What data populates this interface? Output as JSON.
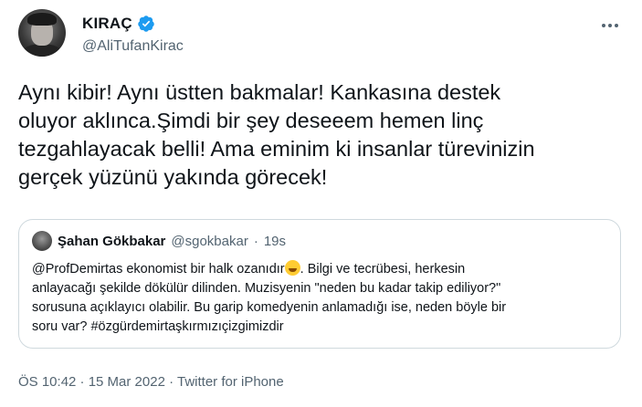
{
  "author": {
    "name": "KIRAÇ",
    "handle": "@AliTufanKirac"
  },
  "tweet": {
    "lines": [
      "Aynı kibir! Aynı üstten bakmalar! Kankasına destek",
      "oluyor aklınca.Şimdi bir şey deseeem hemen linç",
      "tezgahlayacak belli! Ama eminim ki insanlar türevinizin",
      "gerçek yüzünü yakında görecek!"
    ]
  },
  "quote": {
    "name": "Şahan Gökbakar",
    "handle": "@sgokbakar",
    "separator": "·",
    "time": "19s",
    "line1_before_emoji": "@ProfDemirtas ekonomist bir halk ozanıdır",
    "line1_after_emoji": ". Bilgi ve tecrübesi, herkesin",
    "lines": [
      "anlayacağı şekilde dökülür dilinden. Muzisyenin \"neden bu kadar takip ediliyor?\"",
      "sorusuna açıklayıcı olabilir. Bu garip komedyenin anlamadığı ise, neden böyle bir",
      "soru var? #özgürdemirtaşkırmızıçizgimizdir"
    ]
  },
  "footer": {
    "meta": "ÖS 10:42 · 15 Mar 2022 · Twitter for iPhone"
  },
  "colors": {
    "verified": "#1d9bf0",
    "secondary_text": "#536471",
    "border": "#cfd9de"
  }
}
